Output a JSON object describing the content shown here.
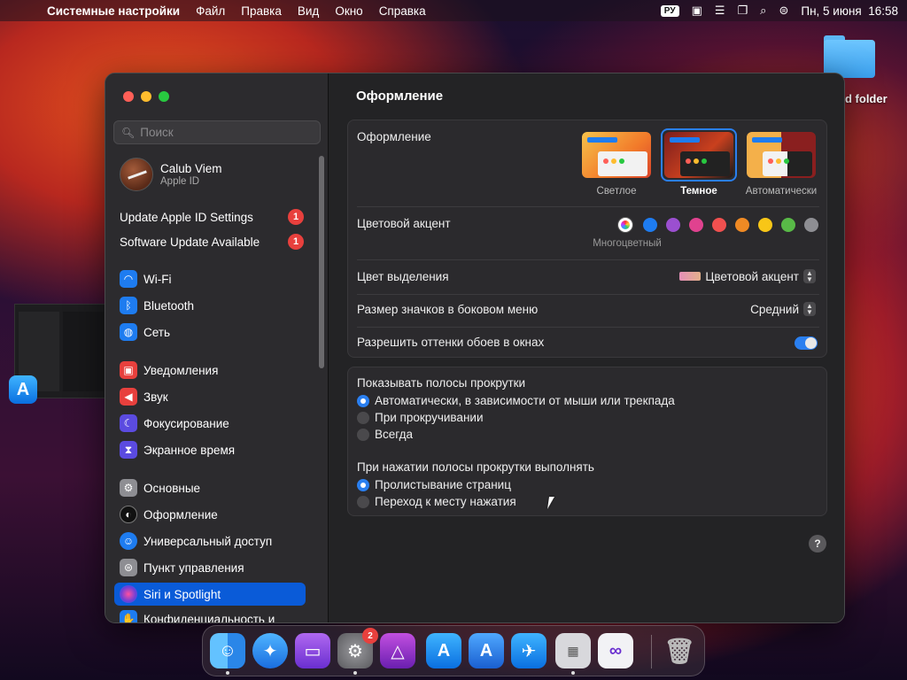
{
  "menubar": {
    "app_name": "Системные настройки",
    "items": [
      "Файл",
      "Правка",
      "Вид",
      "Окно",
      "Справка"
    ],
    "lang": "РУ",
    "datetime": "Пн, 5 июня  16:58"
  },
  "desktop": {
    "folder_label": "d folder"
  },
  "sidebar": {
    "search_placeholder": "Поиск",
    "account": {
      "name": "Calub Viem",
      "subtitle": "Apple ID"
    },
    "alerts": [
      {
        "label": "Update Apple ID Settings",
        "badge": "1"
      },
      {
        "label": "Software Update Available",
        "badge": "1"
      }
    ],
    "items": [
      {
        "label": "Wi-Fi",
        "icon": "wifi-icon",
        "color": "#1e7cf0"
      },
      {
        "label": "Bluetooth",
        "icon": "bluetooth-icon",
        "color": "#1e7cf0"
      },
      {
        "label": "Сеть",
        "icon": "globe-icon",
        "color": "#1e7cf0"
      },
      {
        "label": "Уведомления",
        "icon": "bell-icon",
        "color": "#e8403d"
      },
      {
        "label": "Звук",
        "icon": "speaker-icon",
        "color": "#e8403d"
      },
      {
        "label": "Фокусирование",
        "icon": "moon-icon",
        "color": "#5b4be0"
      },
      {
        "label": "Экранное время",
        "icon": "hourglass-icon",
        "color": "#5b4be0"
      },
      {
        "label": "Основные",
        "icon": "gear-icon",
        "color": "#8e8e93"
      },
      {
        "label": "Оформление",
        "icon": "appearance-icon",
        "color": "#111111"
      },
      {
        "label": "Универсальный доступ",
        "icon": "accessibility-icon",
        "color": "#1e7cf0"
      },
      {
        "label": "Пункт управления",
        "icon": "control-center-icon",
        "color": "#8e8e93"
      },
      {
        "label": "Siri и Spotlight",
        "icon": "siri-icon",
        "color": "#6a3fd8"
      },
      {
        "label": "Конфиденциальность и",
        "icon": "hand-icon",
        "color": "#1e7cf0"
      }
    ],
    "selected": "Siri и Spotlight"
  },
  "content": {
    "title": "Оформление",
    "appearance_label": "Оформление",
    "modes": [
      {
        "label": "Светлое"
      },
      {
        "label": "Темное"
      },
      {
        "label": "Автоматически"
      }
    ],
    "selected_mode": "Темное",
    "accent_label": "Цветовой акцент",
    "accent_caption": "Многоцветный",
    "accent_colors": [
      "#1e7cf0",
      "#9b4fd0",
      "#e0428f",
      "#f0504f",
      "#f08a24",
      "#f8c617",
      "#58b947",
      "#8e8e93"
    ],
    "highlight_label": "Цвет выделения",
    "highlight_value": "Цветовой акцент",
    "icon_size_label": "Размер значков в боковом меню",
    "icon_size_value": "Средний",
    "tinting_label": "Разрешить оттенки обоев в окнах",
    "tinting_on": true,
    "scroll_title": "Показывать полосы прокрутки",
    "scroll_options": [
      {
        "label": "Автоматически, в зависимости от мыши или трекпада",
        "selected": true
      },
      {
        "label": "При прокручивании",
        "selected": false
      },
      {
        "label": "Всегда",
        "selected": false
      }
    ],
    "click_title": "При нажатии полосы прокрутки выполнять",
    "click_options": [
      {
        "label": "Пролистывание страниц",
        "selected": true
      },
      {
        "label": "Переход к месту нажатия",
        "selected": false
      }
    ],
    "help": "?"
  },
  "dock": {
    "apps": [
      "finder-icon",
      "safari-icon",
      "podcasts-icon",
      "settings-icon",
      "affinity-icon",
      "app-store-icon",
      "xcode-icon",
      "testflight-icon",
      "launchpad-icon",
      "visual-studio-icon",
      "trash-icon"
    ],
    "settings_badge": "2"
  }
}
